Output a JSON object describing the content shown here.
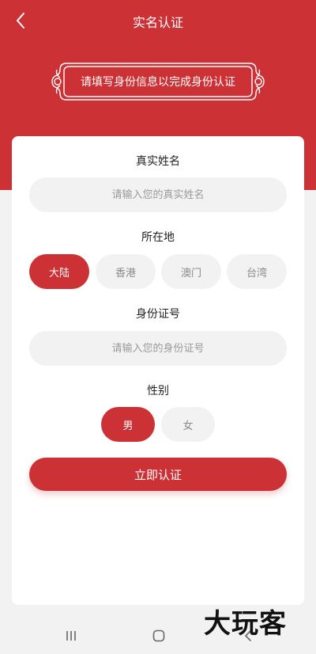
{
  "header": {
    "title": "实名认证"
  },
  "banner": {
    "text": "请填写身份信息以完成身份认证"
  },
  "form": {
    "name_label": "真实姓名",
    "name_placeholder": "请输入您的真实姓名",
    "region_label": "所在地",
    "regions": [
      {
        "label": "大陆",
        "selected": true
      },
      {
        "label": "香港",
        "selected": false
      },
      {
        "label": "澳门",
        "selected": false
      },
      {
        "label": "台湾",
        "selected": false
      }
    ],
    "id_label": "身份证号",
    "id_placeholder": "请输入您的身份证号",
    "gender_label": "性别",
    "genders": [
      {
        "label": "男",
        "selected": true
      },
      {
        "label": "女",
        "selected": false
      }
    ],
    "submit_label": "立即认证"
  },
  "colors": {
    "accent": "#cc3136",
    "field_bg": "#f2f2f2"
  },
  "watermark": {
    "text": "大玩客"
  }
}
